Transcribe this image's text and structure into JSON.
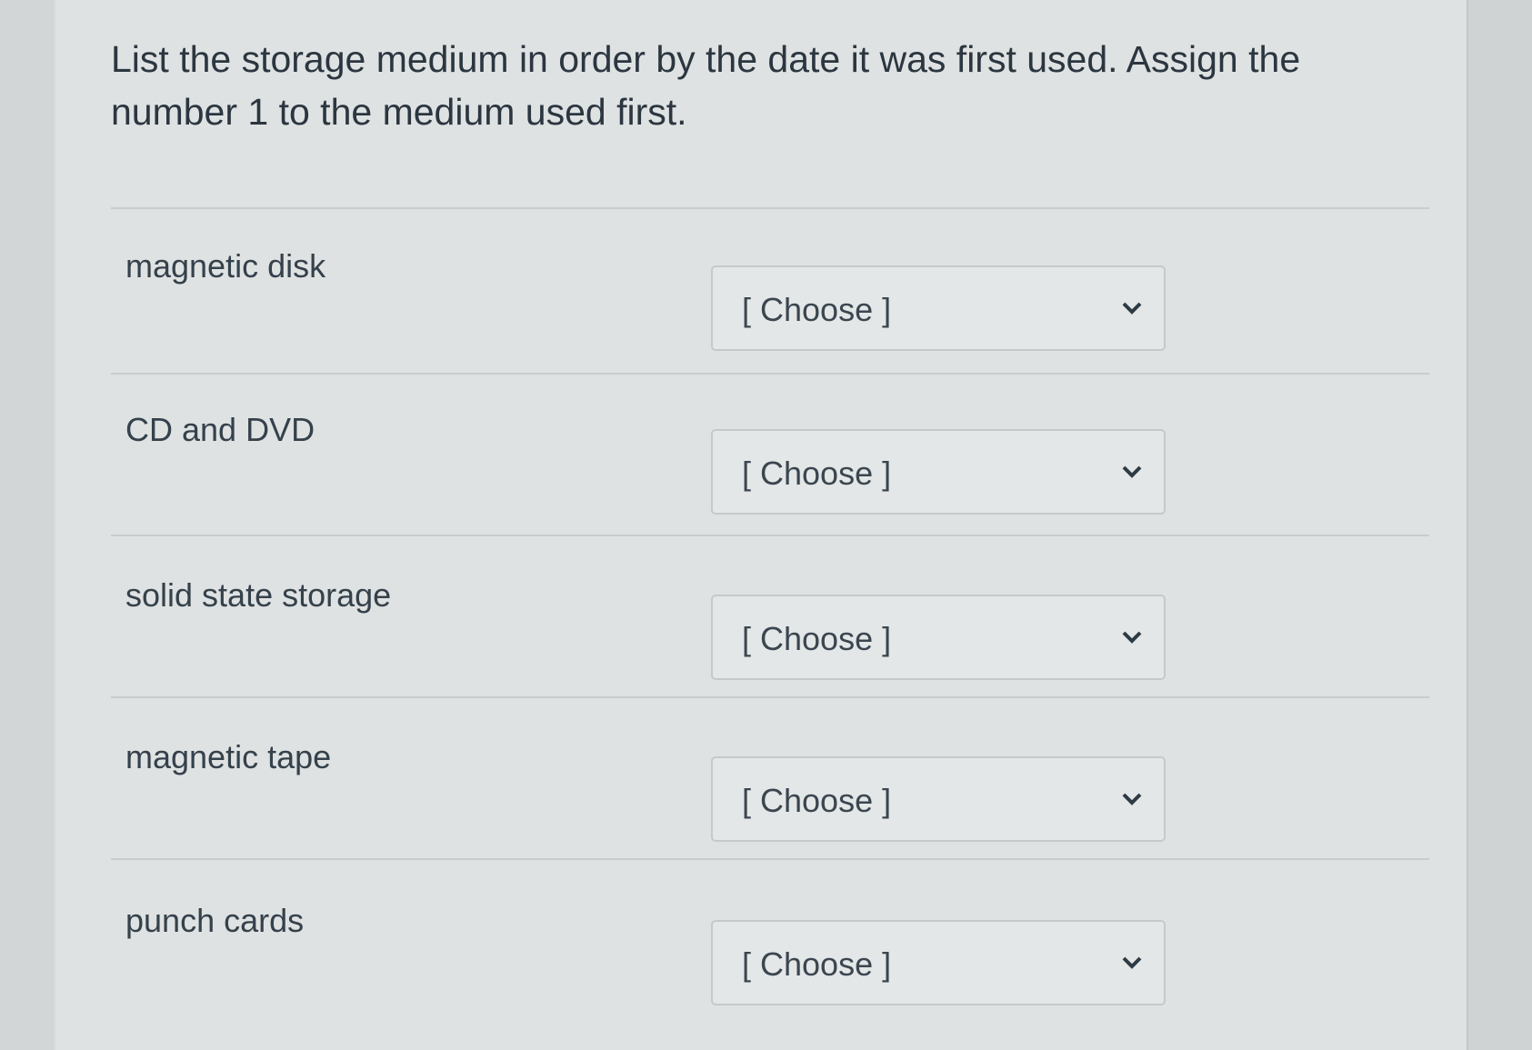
{
  "question": {
    "text": "List the storage medium in order by the date it was first used. Assign the number 1 to the medium used first."
  },
  "rows": [
    {
      "label": "magnetic disk",
      "selected": "[ Choose ]"
    },
    {
      "label": "CD and DVD",
      "selected": "[ Choose ]"
    },
    {
      "label": "solid state storage",
      "selected": "[ Choose ]"
    },
    {
      "label": "magnetic tape",
      "selected": "[ Choose ]"
    },
    {
      "label": "punch cards",
      "selected": "[ Choose ]"
    }
  ],
  "icons": {
    "dropdown": "chevron-down-icon"
  },
  "colors": {
    "text": "#2d3b45",
    "border": "#c6c9c9",
    "background": "#dfe2e2"
  }
}
